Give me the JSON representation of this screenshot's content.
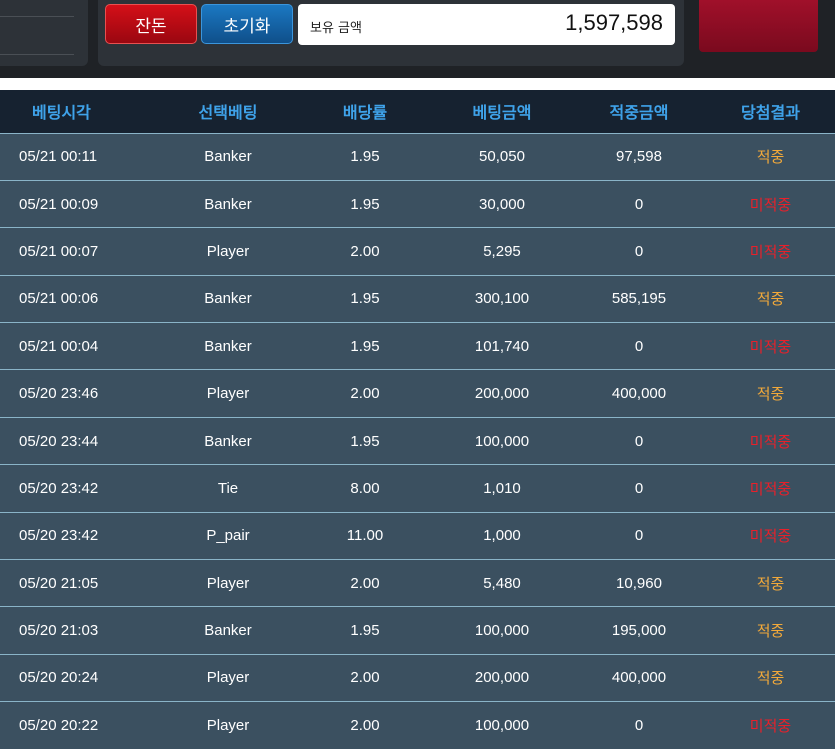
{
  "topbar": {
    "btn_red_label": "잔돈",
    "btn_blue_label": "초기화",
    "balance_label": "보유 금액",
    "balance_value": "1,597,598"
  },
  "table": {
    "headers": [
      "베팅시각",
      "선택베팅",
      "배당률",
      "베팅금액",
      "적중금액",
      "당첨결과"
    ],
    "rows": [
      {
        "time": "05/21 00:11",
        "bet": "Banker",
        "odds": "1.95",
        "amount": "50,050",
        "win_amount": "97,598",
        "result": "적중",
        "status": "win"
      },
      {
        "time": "05/21 00:09",
        "bet": "Banker",
        "odds": "1.95",
        "amount": "30,000",
        "win_amount": "0",
        "result": "미적중",
        "status": "lose"
      },
      {
        "time": "05/21 00:07",
        "bet": "Player",
        "odds": "2.00",
        "amount": "5,295",
        "win_amount": "0",
        "result": "미적중",
        "status": "lose"
      },
      {
        "time": "05/21 00:06",
        "bet": "Banker",
        "odds": "1.95",
        "amount": "300,100",
        "win_amount": "585,195",
        "result": "적중",
        "status": "win"
      },
      {
        "time": "05/21 00:04",
        "bet": "Banker",
        "odds": "1.95",
        "amount": "101,740",
        "win_amount": "0",
        "result": "미적중",
        "status": "lose"
      },
      {
        "time": "05/20 23:46",
        "bet": "Player",
        "odds": "2.00",
        "amount": "200,000",
        "win_amount": "400,000",
        "result": "적중",
        "status": "win"
      },
      {
        "time": "05/20 23:44",
        "bet": "Banker",
        "odds": "1.95",
        "amount": "100,000",
        "win_amount": "0",
        "result": "미적중",
        "status": "lose"
      },
      {
        "time": "05/20 23:42",
        "bet": "Tie",
        "odds": "8.00",
        "amount": "1,010",
        "win_amount": "0",
        "result": "미적중",
        "status": "lose"
      },
      {
        "time": "05/20 23:42",
        "bet": "P_pair",
        "odds": "11.00",
        "amount": "1,000",
        "win_amount": "0",
        "result": "미적중",
        "status": "lose"
      },
      {
        "time": "05/20 21:05",
        "bet": "Player",
        "odds": "2.00",
        "amount": "5,480",
        "win_amount": "10,960",
        "result": "적중",
        "status": "win"
      },
      {
        "time": "05/20 21:03",
        "bet": "Banker",
        "odds": "1.95",
        "amount": "100,000",
        "win_amount": "195,000",
        "result": "적중",
        "status": "win"
      },
      {
        "time": "05/20 20:24",
        "bet": "Player",
        "odds": "2.00",
        "amount": "200,000",
        "win_amount": "400,000",
        "result": "적중",
        "status": "win"
      },
      {
        "time": "05/20 20:22",
        "bet": "Player",
        "odds": "2.00",
        "amount": "100,000",
        "win_amount": "0",
        "result": "미적중",
        "status": "lose"
      }
    ]
  },
  "colors": {
    "header_text": "#3fa3ea",
    "win": "#f2a93a",
    "lose": "#e8202a",
    "row_bg": "#3b5060"
  }
}
